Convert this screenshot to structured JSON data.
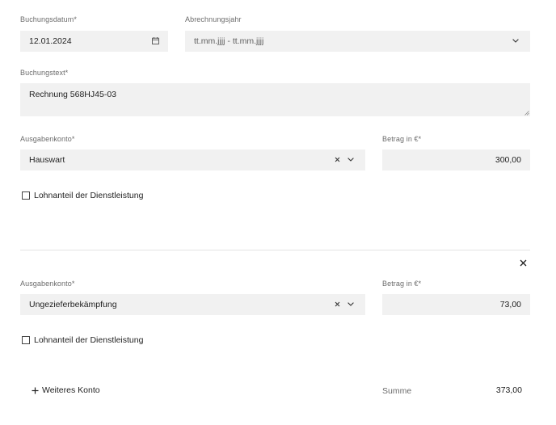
{
  "booking": {
    "date_label": "Buchungsdatum*",
    "date_value": "12.01.2024",
    "year_label": "Abrechnungsjahr",
    "year_placeholder": "tt.mm.jjjj - tt.mm.jjjj",
    "text_label": "Buchungstext*",
    "text_value": "Rechnung 568HJ45-03"
  },
  "accounts": [
    {
      "account_label": "Ausgabenkonto*",
      "account_value": "Hauswart",
      "amount_label": "Betrag in €*",
      "amount_value": "300,00",
      "checkbox_label": "Lohnanteil der Dienstleistung",
      "checked": false
    },
    {
      "account_label": "Ausgabenkonto*",
      "account_value": "Ungezieferbekämpfung",
      "amount_label": "Betrag in €*",
      "amount_value": "73,00",
      "checkbox_label": "Lohnanteil der Dienstleistung",
      "checked": false
    }
  ],
  "footer": {
    "add_account_label": "Weiteres Konto",
    "sum_label": "Summe",
    "sum_value": "373,00"
  },
  "icons": {
    "calendar": "calendar-icon",
    "chevron": "chevron-down-icon",
    "clear": "clear-icon",
    "close": "close-icon",
    "plus": "plus-icon"
  }
}
